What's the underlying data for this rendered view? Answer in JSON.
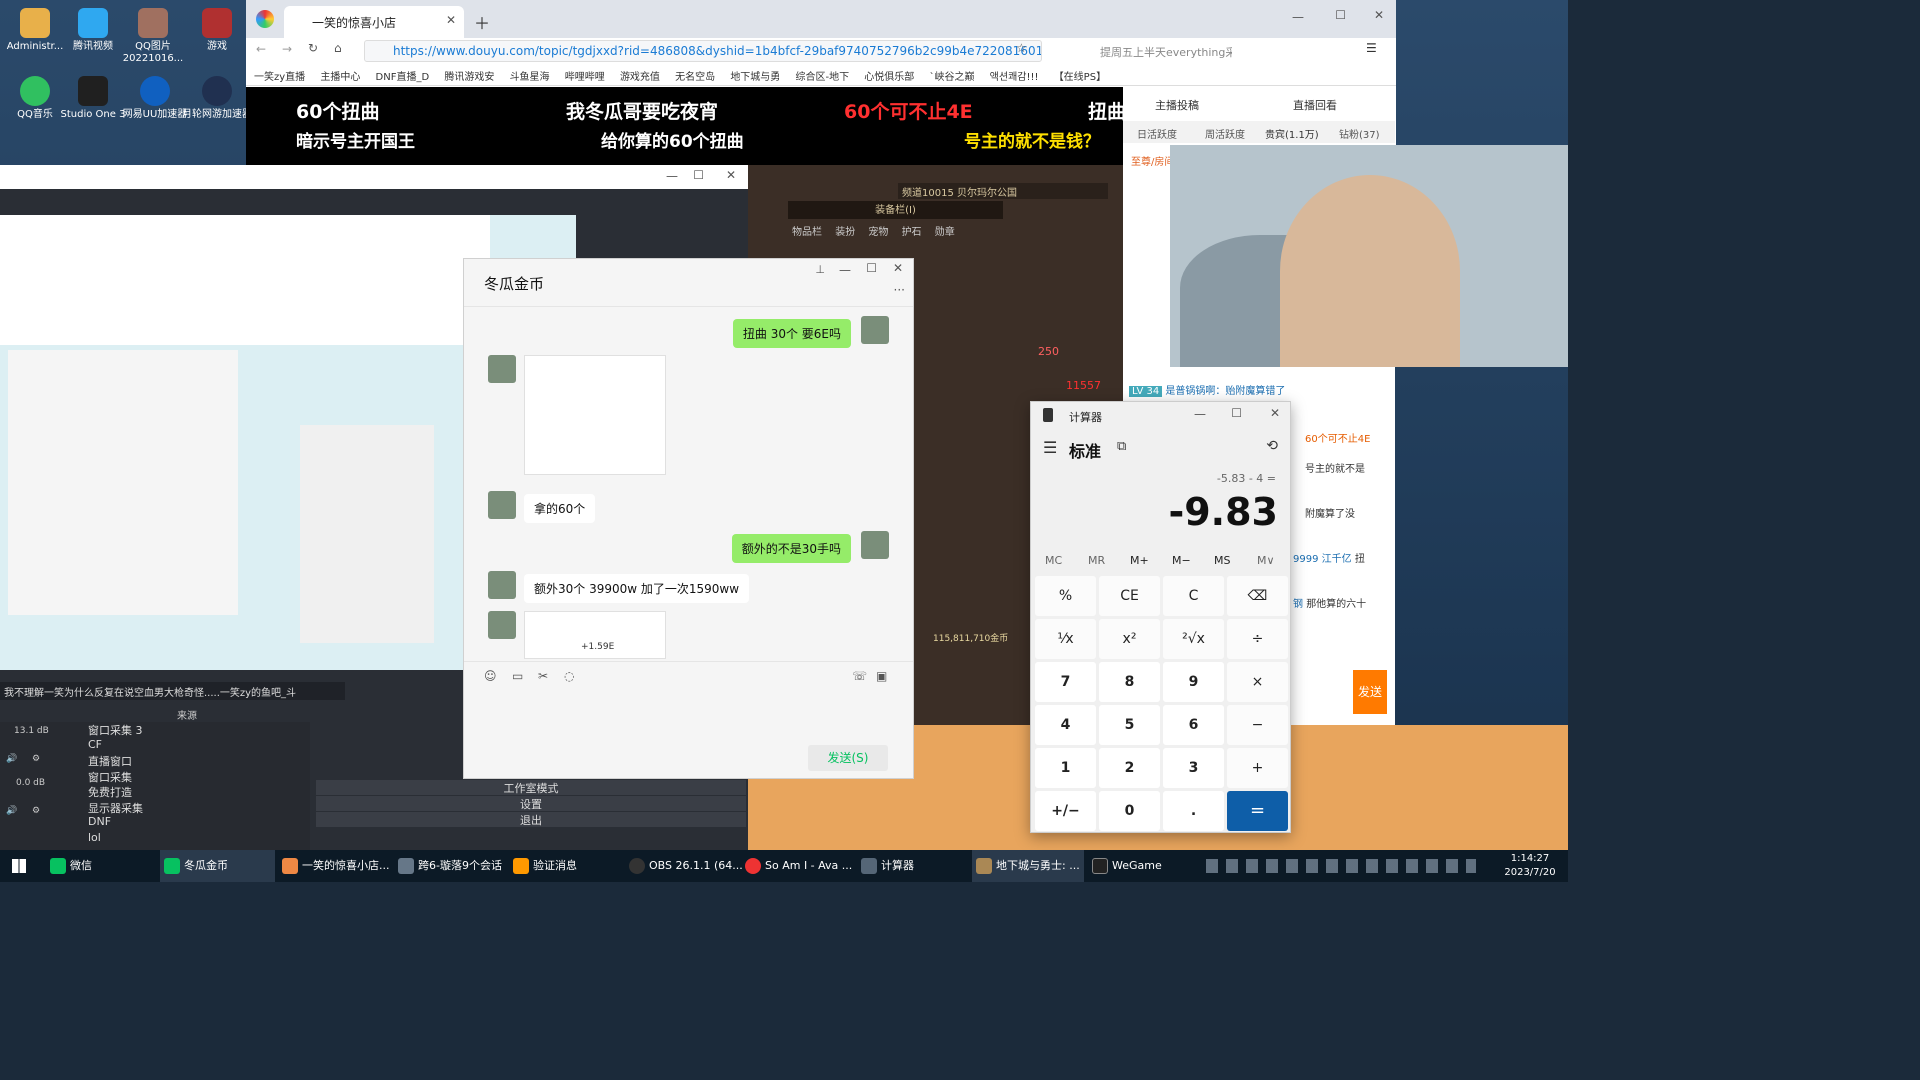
{
  "desktop_icons": [
    {
      "label": "Administr...",
      "color": "#e8b04a"
    },
    {
      "label": "腾讯视频",
      "color": "#2fa8f0"
    },
    {
      "label": "QQ图片20221016...",
      "color": "#a07060"
    },
    {
      "label": "游戏",
      "color": "#b03030"
    },
    {
      "label": "QQ音乐",
      "color": "#30c060"
    },
    {
      "label": "Studio One 3",
      "color": "#202020"
    },
    {
      "label": "网易UU加速器",
      "color": "#1060c0"
    },
    {
      "label": "月轮网游加速器",
      "color": "#203050"
    }
  ],
  "browser": {
    "tab_title": "一笑的惊喜小店",
    "url": "https://www.douyu.com/topic/tgdjxxd?rid=486808&dyshid=1b4bfcf-29baf9740752796b2c99b4e722081601",
    "search_placeholder": "提周五上半天everything采购",
    "bookmarks": [
      "一笑zy直播",
      "主播中心",
      "DNF直播_D",
      "腾讯游戏安",
      "斗鱼星海",
      "哔哩哔哩",
      "游戏充值",
      "无名空岛",
      "地下城与勇",
      "综合区-地下",
      "心悦俱乐部",
      "`峡谷之巅",
      "액션쾌감!!!",
      "【在线PS】"
    ]
  },
  "stream_overlay": {
    "line1": [
      "60个扭曲",
      "我冬瓜哥要吃夜宵",
      "60个可不止4E",
      "扭曲"
    ],
    "line2": [
      "暗示号主开国王",
      "给你算的60个扭曲",
      "号主的就不是钱？"
    ],
    "side": [
      "主播投稿",
      "直播回看",
      "日活跃度",
      "周活跃度",
      "贵宾(1.1万)",
      "钻粉(37)",
      "至尊/房间"
    ]
  },
  "wechat": {
    "title": "冬瓜金币",
    "messages": [
      {
        "from": "me",
        "text": "扭曲 30个 要6E吗"
      },
      {
        "from": "them",
        "text": "拿的60个"
      },
      {
        "from": "me",
        "text": "额外的不是30手吗"
      },
      {
        "from": "them",
        "text": "额外30个 39900w  加了一次1590ww"
      },
      {
        "from": "them",
        "text": "+1.59E"
      }
    ],
    "send": "发送(S)"
  },
  "obs": {
    "marquee": "我不理解一笑为什么反复在说空血男大枪奇怪.....一笑zy的鱼吧_斗",
    "sources_title": "来源",
    "sources": [
      "窗口采集 3",
      "CF",
      "直播窗口",
      "窗口采集",
      "免费打造",
      "显示器采集",
      "DNF",
      "lol"
    ],
    "menu": [
      "工作室模式",
      "设置",
      "退出"
    ],
    "db": [
      "13.1 dB",
      "0.0 dB"
    ]
  },
  "chat": [
    {
      "user": "LV 34",
      "text": "是普锅锅啊：贻附魔算错了"
    },
    {
      "user": "",
      "text": "60个可不止4E"
    },
    {
      "user": "",
      "text": "号主的就不是"
    },
    {
      "user": "",
      "text": "附魔算了没"
    },
    {
      "user": "9999 江千亿",
      "text": "扭"
    },
    {
      "user": "钢",
      "text": "那他算的六十"
    }
  ],
  "chat_send": "发送",
  "calculator": {
    "title": "计算器",
    "mode": "标准",
    "expression": "-5.83 - 4 =",
    "display": "-9.83",
    "memory": [
      "MC",
      "MR",
      "M+",
      "M−",
      "MS",
      "M∨"
    ],
    "keys": [
      "%",
      "CE",
      "C",
      "⌫",
      "¹⁄x",
      "x²",
      "²√x",
      "÷",
      "7",
      "8",
      "9",
      "×",
      "4",
      "5",
      "6",
      "−",
      "1",
      "2",
      "3",
      "+",
      "+/−",
      "0",
      ".",
      "="
    ]
  },
  "game": {
    "window": "装备栏(I)",
    "channel": "频道10015 贝尔玛尔公国",
    "tabs": [
      "物品栏",
      "装扮",
      "宠物",
      "护石",
      "勋章"
    ],
    "gold": "115,811,710金币",
    "num": "11557",
    "n2": "250"
  },
  "taskbar": {
    "items": [
      "微信",
      "冬瓜金币",
      "一笑的惊喜小店...",
      "跨6-璇落9个会话",
      "验证消息",
      "OBS 26.1.1 (64...",
      "So Am I - Ava ...",
      "计算器",
      "地下城与勇士: ...",
      "WeGame"
    ],
    "time": "1:14:27",
    "date": "2023/7/20"
  }
}
